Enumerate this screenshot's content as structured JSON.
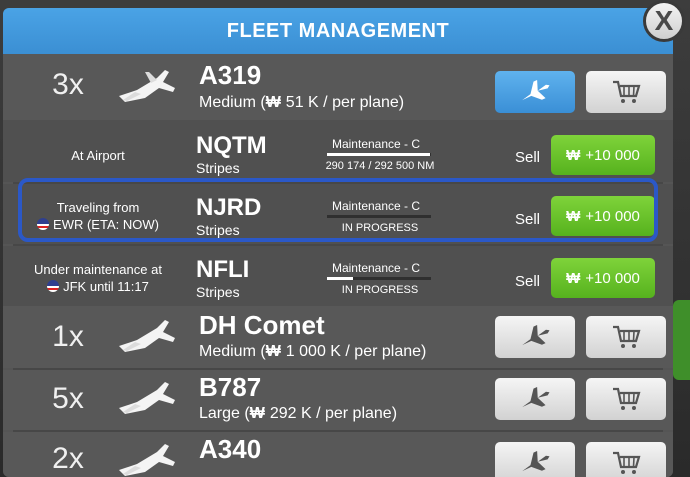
{
  "header": {
    "title": "FLEET MANAGEMENT",
    "close_label": "X"
  },
  "colors": {
    "header_blue": "#3b8fd3",
    "buy_green": "#56b21e",
    "highlight_blue": "#2b58c7",
    "panel_gray": "#555555"
  },
  "currency_symbol": "₩",
  "models": [
    {
      "qty": "3x",
      "name": "A319",
      "size": "Medium",
      "price": "51 K",
      "unit": "/ per plane",
      "icon": "airplane-icon",
      "selected": true
    },
    {
      "qty": "1x",
      "name": "DH Comet",
      "size": "Medium",
      "price": "1 000 K",
      "unit": "/ per plane",
      "icon": "airplane-icon",
      "selected": false
    },
    {
      "qty": "5x",
      "name": "B787",
      "size": "Large",
      "price": "292 K",
      "unit": "/ per plane",
      "icon": "airplane-icon",
      "selected": false
    },
    {
      "qty": "2x",
      "name": "A340",
      "size": "",
      "price": "",
      "unit": "",
      "icon": "airplane-icon",
      "selected": false
    }
  ],
  "aircraft": [
    {
      "status_line1": "At Airport",
      "status_line2": "",
      "registration": "NQTM",
      "livery": "Stripes",
      "maintenance_label": "Maintenance - C",
      "maintenance_detail": "290 174 /  292 500 NM",
      "maintenance_progress": 0.99,
      "sell_label": "Sell",
      "sell_value": "+10 000"
    },
    {
      "status_line1": "Traveling from",
      "status_line2": "EWR (ETA: NOW)",
      "registration": "NJRD",
      "livery": "Stripes",
      "maintenance_label": "Maintenance - C",
      "maintenance_detail": "IN PROGRESS",
      "maintenance_progress": 0.0,
      "sell_label": "Sell",
      "sell_value": "+10 000"
    },
    {
      "status_line1": "Under maintenance at",
      "status_line2": "JFK until 11:17",
      "registration": "NFLI",
      "livery": "Stripes",
      "maintenance_label": "Maintenance - C",
      "maintenance_detail": "IN PROGRESS",
      "maintenance_progress": 0.25,
      "sell_label": "Sell",
      "sell_value": "+10 000"
    }
  ]
}
